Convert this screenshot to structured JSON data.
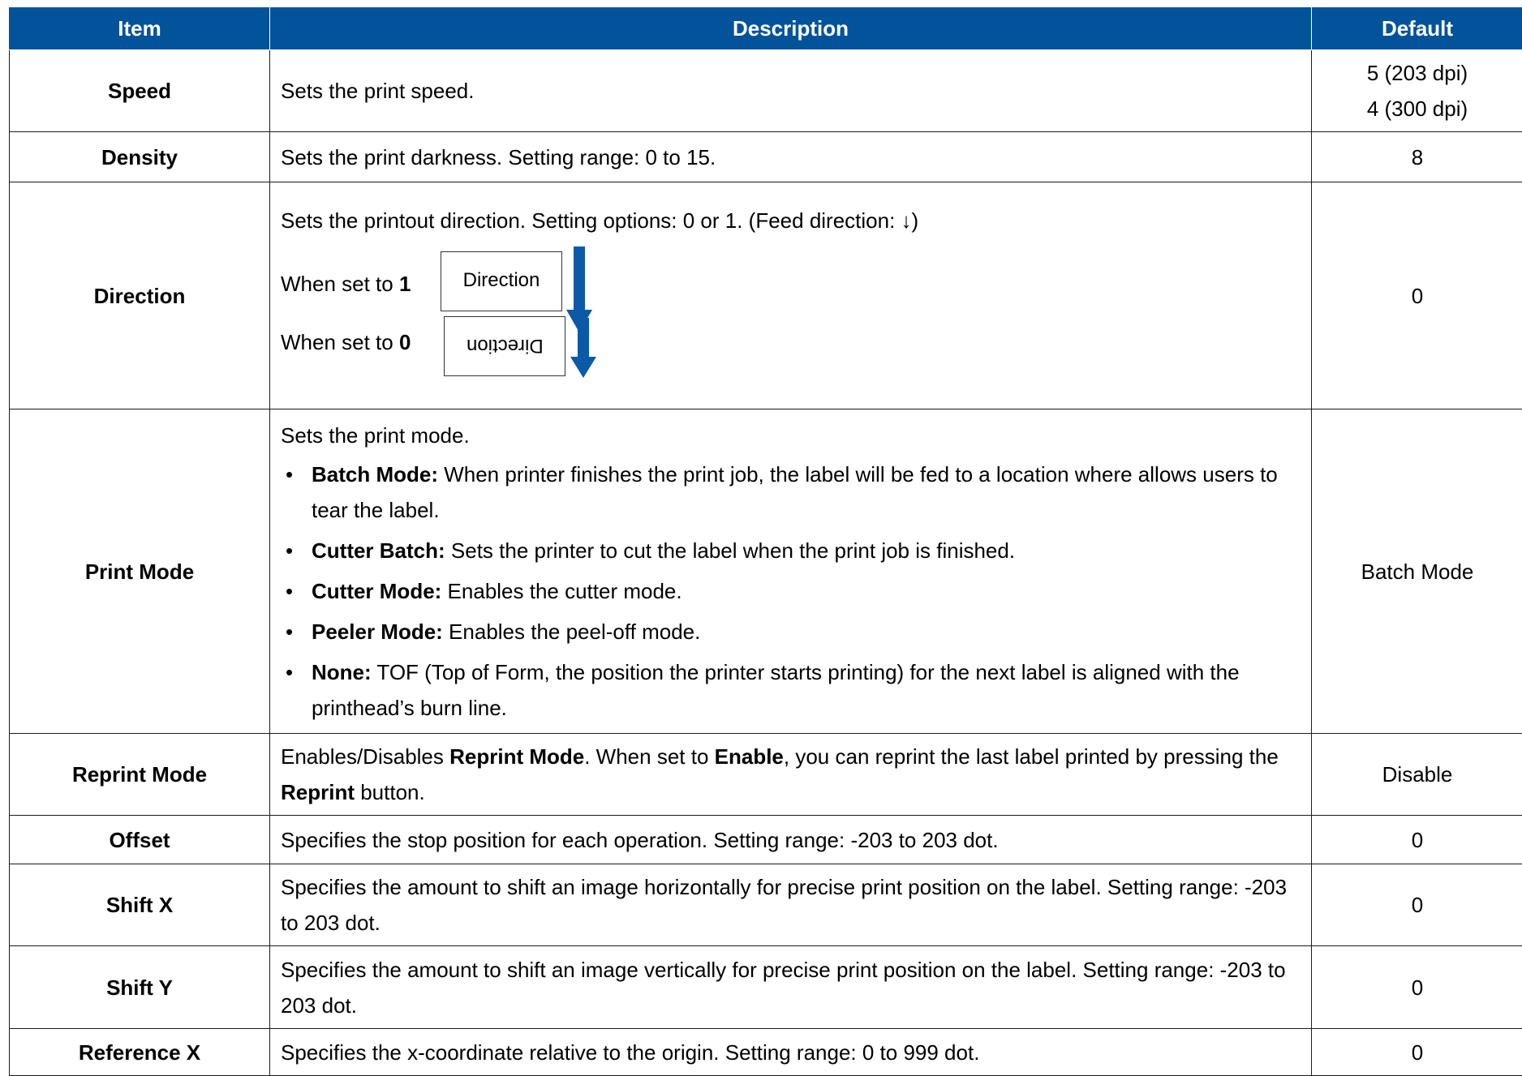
{
  "headers": {
    "item": "Item",
    "description": "Description",
    "default": "Default"
  },
  "rows": {
    "speed": {
      "item": "Speed",
      "desc": "Sets the print speed.",
      "default_line1": "5 (203 dpi)",
      "default_line2": "4 (300 dpi)"
    },
    "density": {
      "item": "Density",
      "desc": "Sets the print darkness. Setting range: 0 to 15.",
      "default": "8"
    },
    "direction": {
      "item": "Direction",
      "desc": "Sets the printout direction. Setting options: 0 or 1. (Feed direction: ↓)",
      "set1_prefix": "When set to ",
      "set1_value": "1",
      "set0_prefix": "When set to ",
      "set0_value": "0",
      "box_label": "Direction",
      "default": "0",
      "arrow_color": "#0a5aa8"
    },
    "print_mode": {
      "item": "Print Mode",
      "intro": "Sets the print mode.",
      "bullets": [
        {
          "term": "Batch Mode:",
          "text": " When printer finishes the print job, the label will be fed to a location where allows users to tear the label."
        },
        {
          "term": "Cutter Batch:",
          "text": " Sets the printer to cut the label when the print job is finished."
        },
        {
          "term": "Cutter Mode:",
          "text": " Enables the cutter mode."
        },
        {
          "term": "Peeler Mode:",
          "text": " Enables the peel-off mode."
        },
        {
          "term": "None:",
          "text": " TOF (Top of Form, the position the printer starts printing) for the next label is aligned with the printhead’s burn line."
        }
      ],
      "default": "Batch Mode"
    },
    "reprint_mode": {
      "item": "Reprint Mode",
      "p1": "Enables/Disables ",
      "b1": "Reprint Mode",
      "p2": ". When set to ",
      "b2": "Enable",
      "p3": ", you can reprint the last label printed by pressing the ",
      "b3": "Reprint",
      "p4": " button.",
      "default": "Disable"
    },
    "offset": {
      "item": "Offset",
      "desc": "Specifies the stop position for each operation. Setting range: -203 to 203 dot.",
      "default": "0"
    },
    "shift_x": {
      "item": "Shift X",
      "desc": "Specifies the amount to shift an image horizontally for precise print position on the label. Setting range: -203 to 203 dot.",
      "default": "0"
    },
    "shift_y": {
      "item": "Shift Y",
      "desc": "Specifies the amount to shift an image vertically for precise print position on the label. Setting range: -203 to 203 dot.",
      "default": "0"
    },
    "reference_x": {
      "item": "Reference X",
      "desc": "Specifies the x-coordinate relative to the origin. Setting range: 0 to 999 dot.",
      "default": "0"
    }
  },
  "colors": {
    "header_bg": "#02539a",
    "header_text": "#ffffff",
    "border": "#1a1a1a"
  }
}
